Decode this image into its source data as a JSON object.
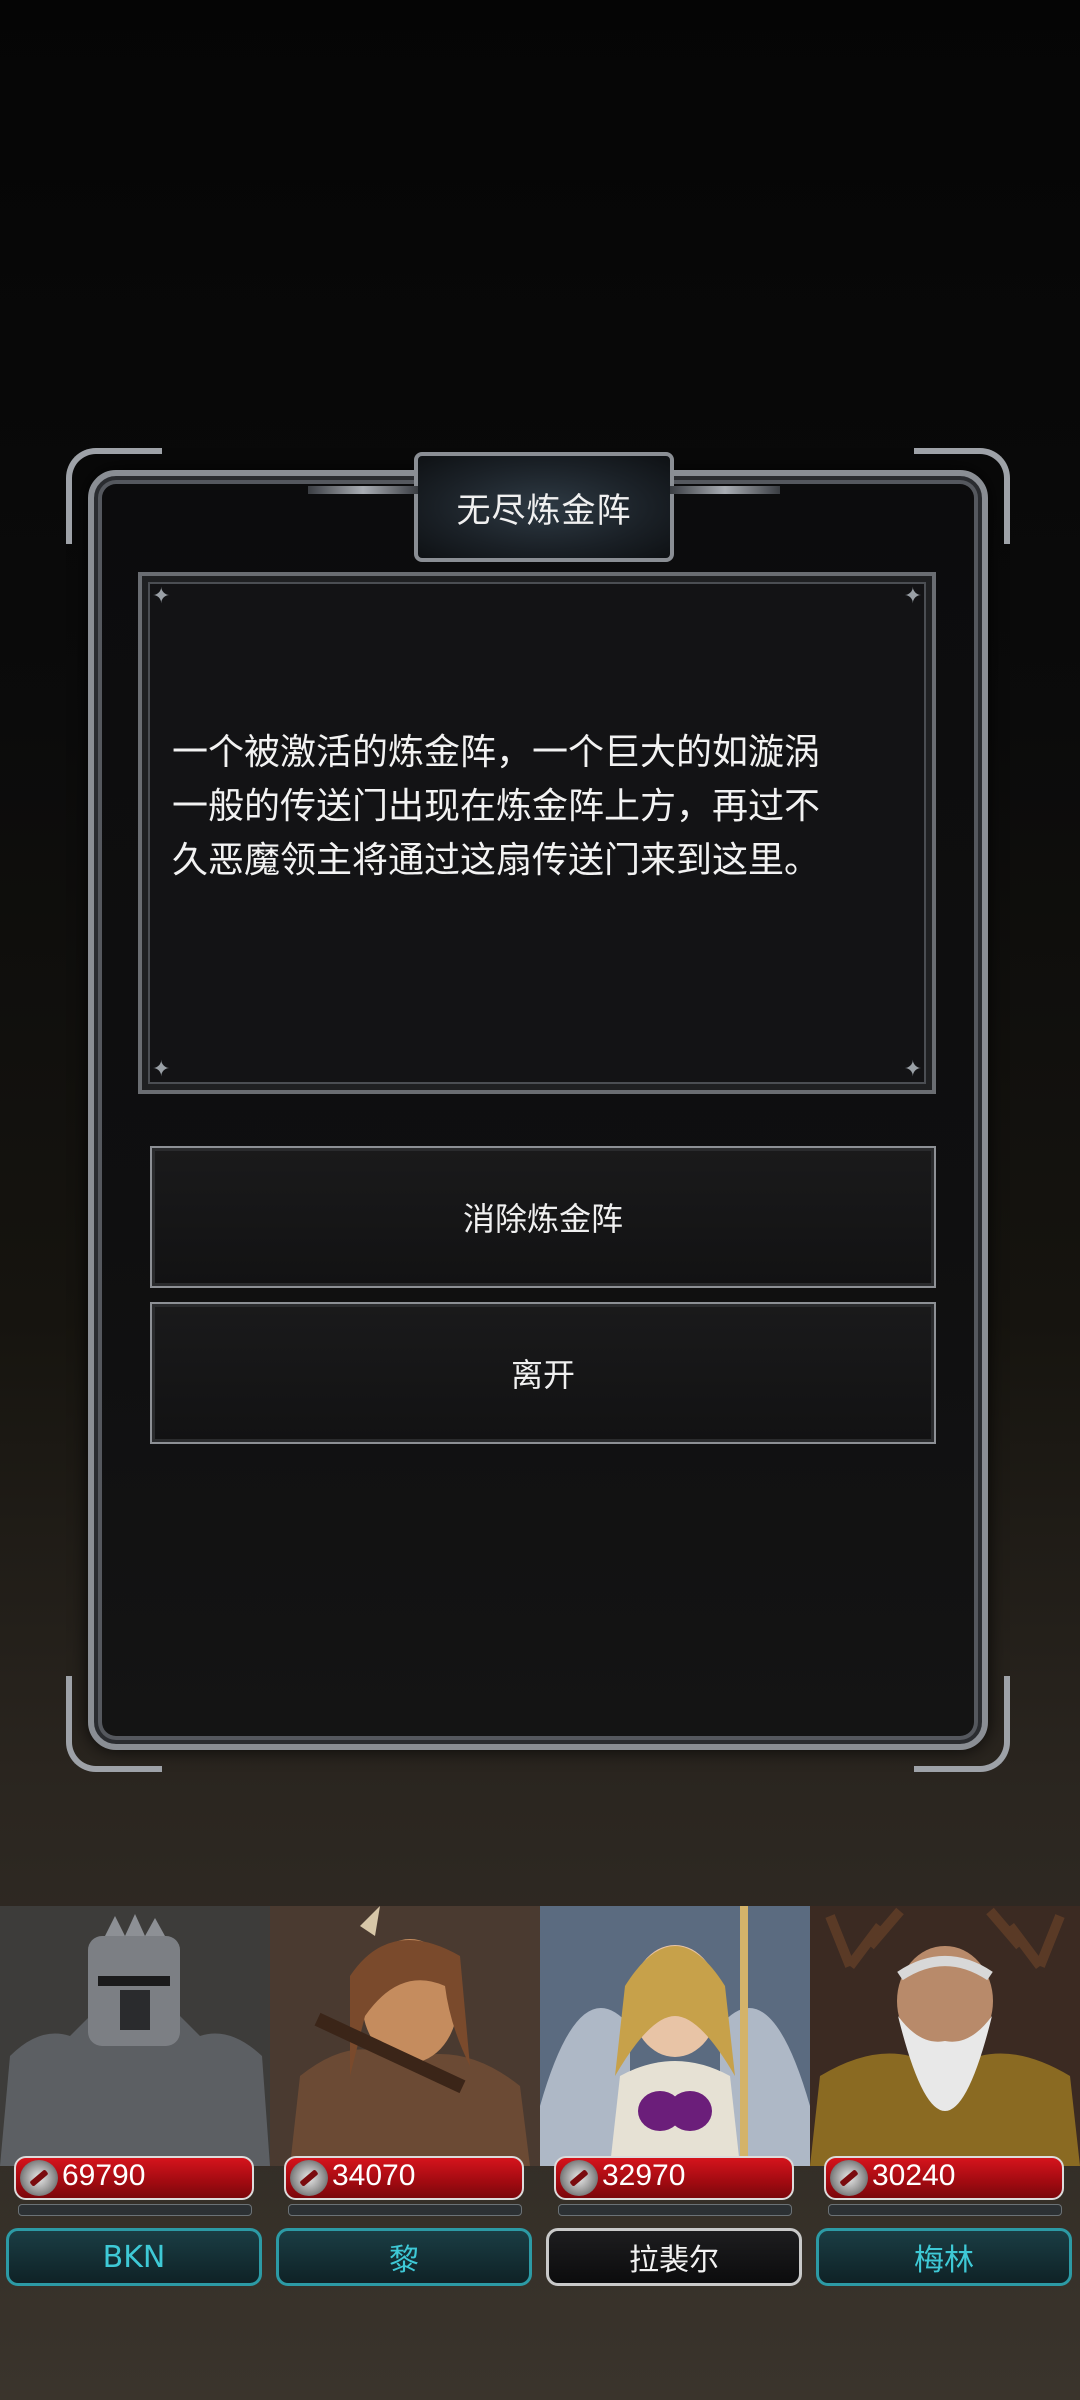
{
  "event": {
    "title": "无尽炼金阵",
    "text": "一个被激活的炼金阵，一个巨大的如漩涡\n一般的传送门出现在炼金阵上方，再过不\n久恶魔领主将通过这扇传送门来到这里。",
    "choices": [
      {
        "label": "消除炼金阵"
      },
      {
        "label": "离开"
      }
    ]
  },
  "party": [
    {
      "name": "BKN",
      "hp": "69790",
      "hp_fill": 1.0,
      "selected": false,
      "icon": "armored-knight-portrait",
      "colors": {
        "bg": "#3d3c3a",
        "figure": "#7c7f84",
        "accent": "#1b1b1c"
      }
    },
    {
      "name": "黎",
      "hp": "34070",
      "hp_fill": 1.0,
      "selected": false,
      "icon": "warrior-woman-portrait",
      "colors": {
        "bg": "#4a3a30",
        "figure": "#7a4a2c",
        "accent": "#c58c5e"
      }
    },
    {
      "name": "拉裴尔",
      "hp": "32970",
      "hp_fill": 1.0,
      "selected": true,
      "icon": "angel-priestess-portrait",
      "colors": {
        "bg": "#5b6b80",
        "figure": "#c7a14a",
        "accent": "#6b1e7a"
      }
    },
    {
      "name": "梅林",
      "hp": "30240",
      "hp_fill": 1.0,
      "selected": false,
      "icon": "antlered-sage-portrait",
      "colors": {
        "bg": "#3b2a22",
        "figure": "#b3a67c",
        "accent": "#e8e8e8"
      }
    }
  ],
  "colors": {
    "hp_red": "#c1121a",
    "name_teal": "#3ec9d6",
    "frame_silver": "#8a8e94"
  }
}
